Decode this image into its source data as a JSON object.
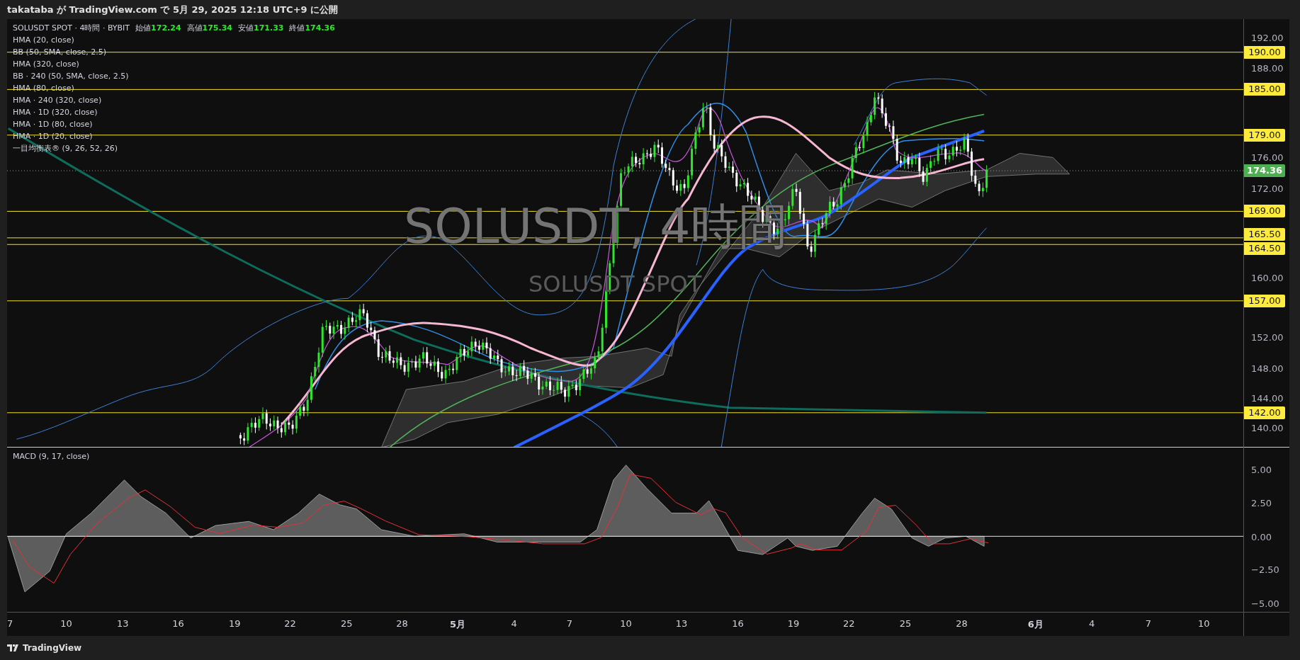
{
  "header": {
    "text": "takataba が TradingView.com で 5月 29, 2025 12:18 UTC+9 に公開"
  },
  "legend": {
    "symbol": "SOLUSDT SPOT · 4時間 · BYBIT",
    "ohlc": [
      {
        "label": "始値",
        "value": "172.24"
      },
      {
        "label": "高値",
        "value": "175.34"
      },
      {
        "label": "安値",
        "value": "171.33"
      },
      {
        "label": "終値",
        "value": "174.36"
      }
    ],
    "indicators": [
      "HMA (20, close)",
      "BB (50, SMA, close, 2.5)",
      "HMA (320, close)",
      "BB · 240 (50, SMA, close, 2.5)",
      "HMA (80, close)",
      "HMA · 240 (320, close)",
      "HMA · 1D (320, close)",
      "HMA · 1D (80, close)",
      "HMA · 1D (20, close)",
      "一目均衡表® (9, 26, 52, 26)"
    ]
  },
  "watermark": {
    "title": "SOLUSDT, 4時間",
    "subtitle": "SOLUSDT SPOT"
  },
  "price_axis": {
    "ticks": [
      "192.00",
      "188.00",
      "176.00",
      "172.00",
      "160.00",
      "152.00",
      "148.00",
      "144.00",
      "140.00"
    ],
    "levels": [
      "190.00",
      "185.00",
      "179.00",
      "169.00",
      "165.50",
      "164.50",
      "157.00",
      "142.00"
    ],
    "last_price": "174.36"
  },
  "macd": {
    "title": "MACD (9, 17, close)",
    "ticks": [
      "5.00",
      "2.50",
      "0.00",
      "−2.50",
      "−5.00"
    ]
  },
  "time_axis": [
    {
      "label": "7",
      "kind": "day"
    },
    {
      "label": "10",
      "kind": "day"
    },
    {
      "label": "13",
      "kind": "day"
    },
    {
      "label": "16",
      "kind": "day"
    },
    {
      "label": "19",
      "kind": "day"
    },
    {
      "label": "22",
      "kind": "day"
    },
    {
      "label": "25",
      "kind": "day"
    },
    {
      "label": "28",
      "kind": "day"
    },
    {
      "label": "5月",
      "kind": "month"
    },
    {
      "label": "4",
      "kind": "day"
    },
    {
      "label": "7",
      "kind": "day"
    },
    {
      "label": "10",
      "kind": "day"
    },
    {
      "label": "13",
      "kind": "day"
    },
    {
      "label": "16",
      "kind": "day"
    },
    {
      "label": "19",
      "kind": "day"
    },
    {
      "label": "22",
      "kind": "day"
    },
    {
      "label": "25",
      "kind": "day"
    },
    {
      "label": "28",
      "kind": "day"
    },
    {
      "label": "6月",
      "kind": "month"
    },
    {
      "label": "4",
      "kind": "day"
    },
    {
      "label": "7",
      "kind": "day"
    },
    {
      "label": "10",
      "kind": "day"
    }
  ],
  "footer": {
    "brand": "TradingView"
  }
}
